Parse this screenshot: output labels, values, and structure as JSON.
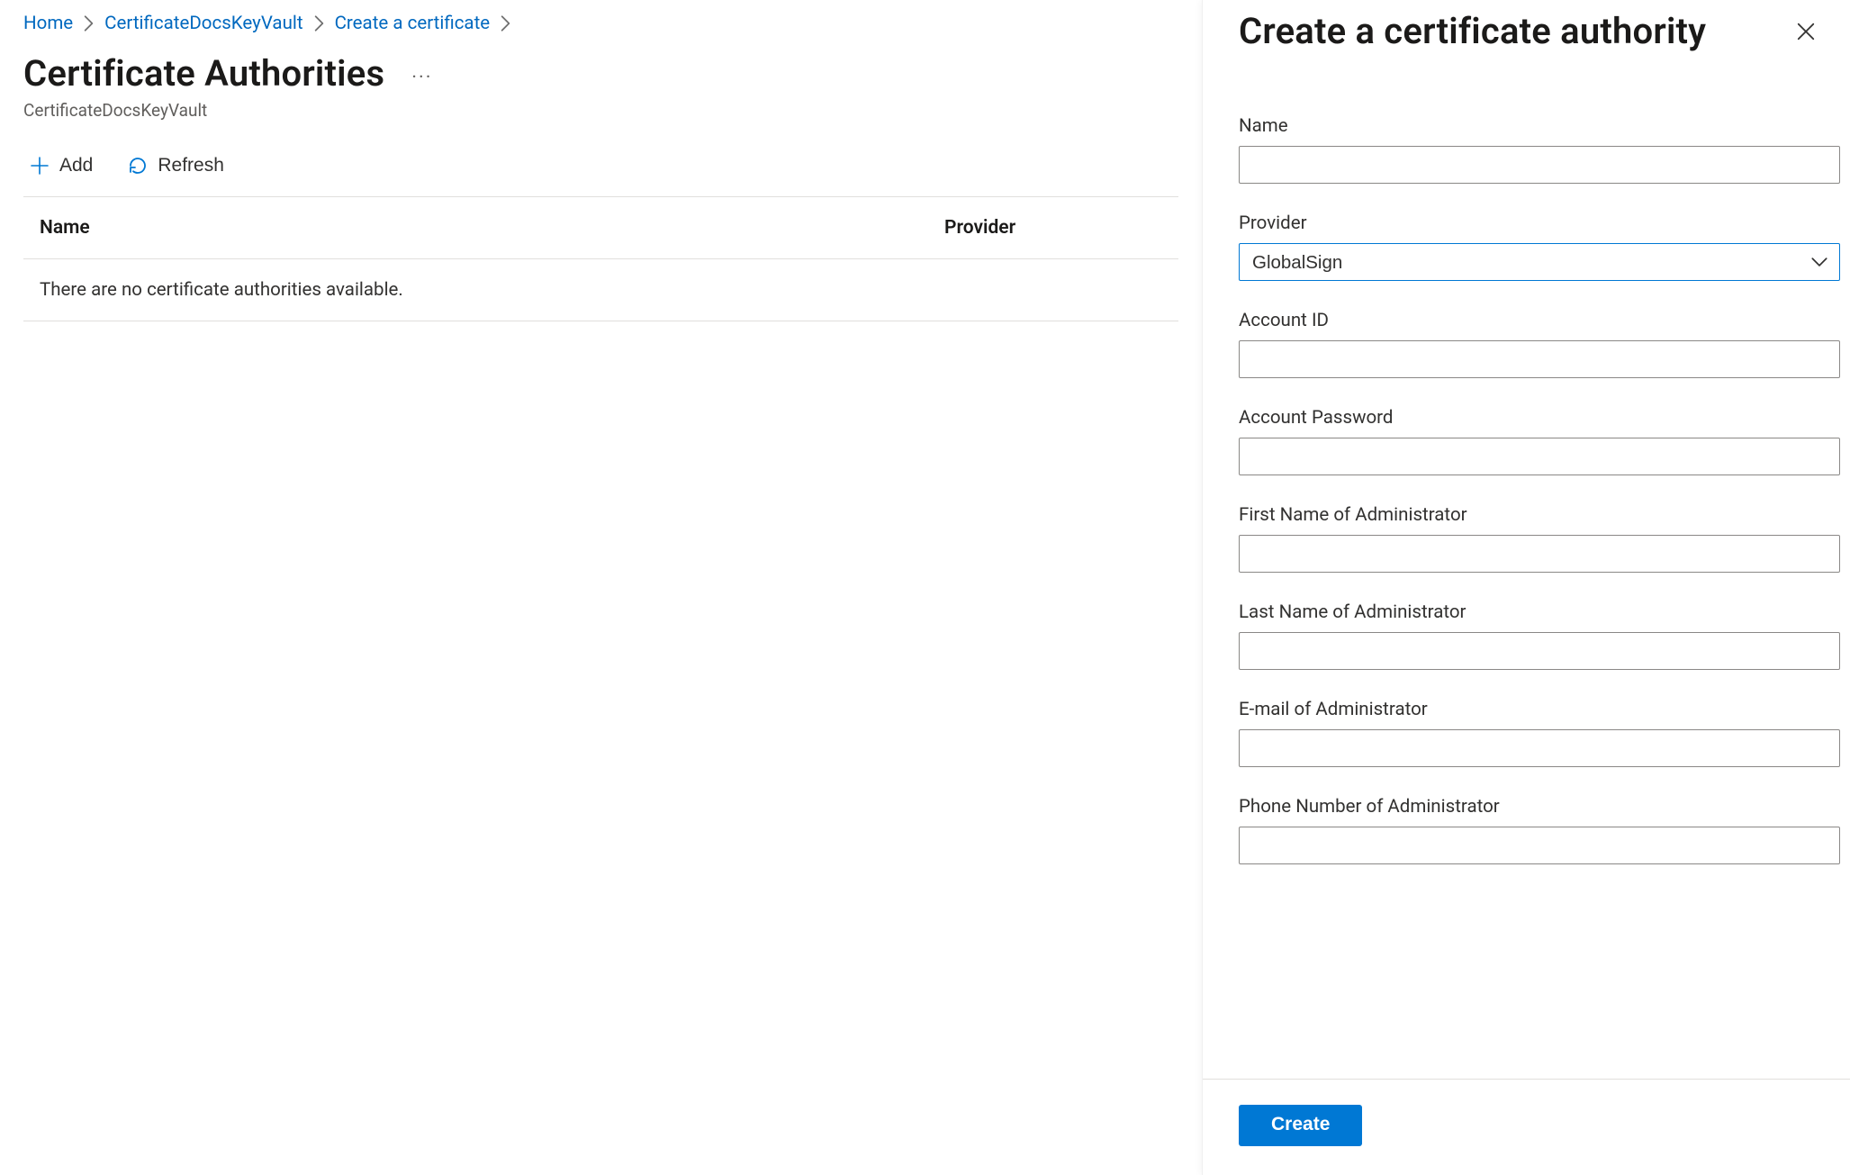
{
  "breadcrumb": {
    "items": [
      {
        "label": "Home"
      },
      {
        "label": "CertificateDocsKeyVault"
      },
      {
        "label": "Create a certificate"
      }
    ]
  },
  "page": {
    "title": "Certificate Authorities",
    "subtitle": "CertificateDocsKeyVault"
  },
  "toolbar": {
    "add_label": "Add",
    "refresh_label": "Refresh"
  },
  "table": {
    "columns": {
      "name": "Name",
      "provider": "Provider"
    },
    "empty_message": "There are no certificate authorities available."
  },
  "panel": {
    "title": "Create a certificate authority",
    "fields": {
      "name": {
        "label": "Name",
        "value": ""
      },
      "provider": {
        "label": "Provider",
        "value": "GlobalSign"
      },
      "account_id": {
        "label": "Account ID",
        "value": ""
      },
      "account_password": {
        "label": "Account Password",
        "value": ""
      },
      "admin_first": {
        "label": "First Name of Administrator",
        "value": ""
      },
      "admin_last": {
        "label": "Last Name of Administrator",
        "value": ""
      },
      "admin_email": {
        "label": "E-mail of Administrator",
        "value": ""
      },
      "admin_phone": {
        "label": "Phone Number of Administrator",
        "value": ""
      }
    },
    "create_label": "Create"
  }
}
